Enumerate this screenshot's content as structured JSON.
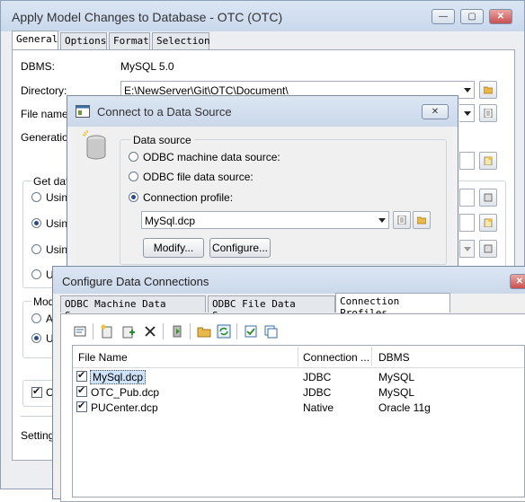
{
  "main_window": {
    "title": "Apply Model Changes to Database - OTC (OTC)",
    "tabs": [
      "General",
      "Options",
      "Format",
      "Selection"
    ],
    "dbms_label": "DBMS:",
    "dbms_value": "MySQL 5.0",
    "directory_label": "Directory:",
    "directory_value": "E:\\NewServer\\Git\\OTC\\Document\\",
    "filename_label": "File name:",
    "generation_label": "Generation",
    "get_data_label": "Get data",
    "using_1": "Using",
    "using_2": "Using",
    "using_3": "Using",
    "u_4": "U",
    "mod_label": "Mod",
    "a_option": "A",
    "u_option": "U",
    "c_checkbox": "C",
    "settings_label": "Setting"
  },
  "connect_dialog": {
    "title": "Connect to a Data Source",
    "group_label": "Data source",
    "options": [
      "ODBC machine data source:",
      "ODBC file data source:",
      "Connection profile:"
    ],
    "selected_option": "Connection profile:",
    "profile_value": "MySql.dcp",
    "modify_button": "Modify...",
    "configure_button": "Configure..."
  },
  "config_dialog": {
    "title": "Configure Data Connections",
    "tabs": [
      "ODBC Machine Data Sources",
      "ODBC File Data Sources",
      "Connection Profiles"
    ],
    "active_tab": "Connection Profiles",
    "columns": [
      "File Name",
      "Connection ...",
      "DBMS"
    ],
    "rows": [
      {
        "name": "MySql.dcp",
        "connection": "JDBC",
        "dbms": "MySQL",
        "checked": true,
        "selected": true
      },
      {
        "name": "OTC_Pub.dcp",
        "connection": "JDBC",
        "dbms": "MySQL",
        "checked": true,
        "selected": false
      },
      {
        "name": "PUCenter.dcp",
        "connection": "Native",
        "dbms": "Oracle 11g",
        "checked": true,
        "selected": false
      }
    ]
  },
  "colors": {
    "selection": "#cfe3fb",
    "title_bar": "#cad8ea",
    "accent": "#2b4c7e"
  }
}
